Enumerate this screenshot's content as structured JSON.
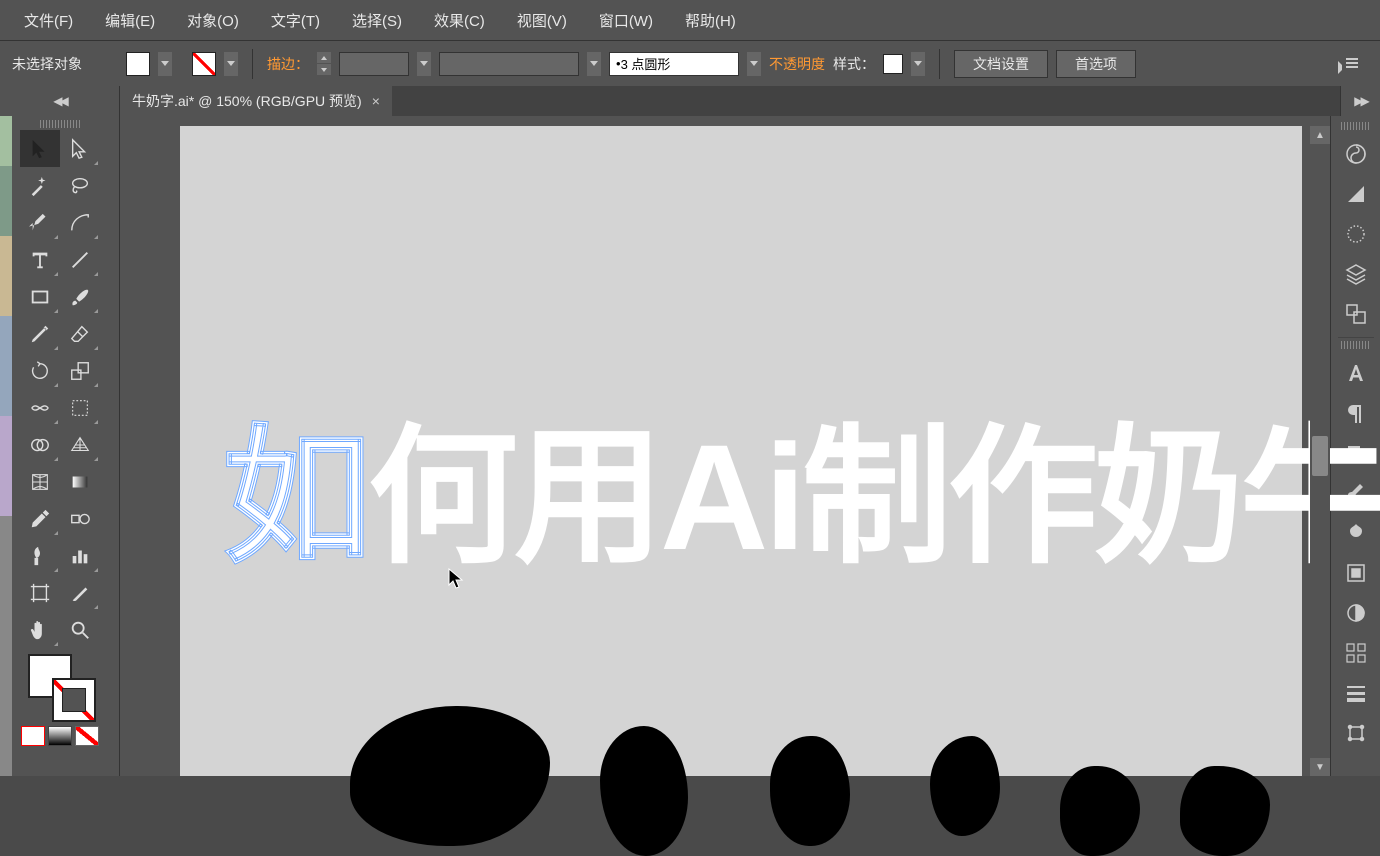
{
  "menu": {
    "file": "文件(F)",
    "edit": "编辑(E)",
    "object": "对象(O)",
    "type": "文字(T)",
    "select": "选择(S)",
    "effect": "效果(C)",
    "view": "视图(V)",
    "window": "窗口(W)",
    "help": "帮助(H)"
  },
  "optbar": {
    "no_selection": "未选择对象",
    "stroke_label": "描边：",
    "stroke_profile": "3 点圆形",
    "opacity_label": "不透明度",
    "style_label": "样式：",
    "doc_setup": "文档设置",
    "preferences": "首选项"
  },
  "tab": {
    "title": "牛奶字.ai* @ 150% (RGB/GPU 预览)",
    "close": "×"
  },
  "canvas": {
    "text": "如何用Ai制作奶牛",
    "selected_char": "如"
  },
  "tools": {
    "selection": "selection",
    "direct": "direct-selection",
    "wand": "magic-wand",
    "lasso": "lasso",
    "pen": "pen",
    "curve": "curvature",
    "text": "type",
    "line": "line",
    "rect": "rectangle",
    "brush": "paintbrush",
    "pencil": "pencil",
    "eraser": "eraser",
    "rotate": "rotate",
    "reflect": "scale",
    "width": "width",
    "warp": "free-transform",
    "shapebuilder": "shape-builder",
    "persp": "perspective",
    "mesh": "mesh",
    "gradient": "gradient",
    "eyedrop": "eyedropper",
    "blend": "blend",
    "spray": "symbol-sprayer",
    "graph": "column-graph",
    "artboard": "artboard",
    "slice": "slice",
    "hand": "hand",
    "zoom": "zoom"
  },
  "right_panels": {
    "color": "color",
    "guide": "color-guide",
    "circle": "blend",
    "layers": "layers",
    "artboards": "artboards",
    "char": "character",
    "para": "paragraph",
    "align": "align",
    "brushes": "brushes",
    "symbols": "symbols",
    "swatches": "swatches",
    "stroke": "stroke",
    "transparency": "transparency",
    "appearance": "appearance",
    "transform": "transform"
  }
}
